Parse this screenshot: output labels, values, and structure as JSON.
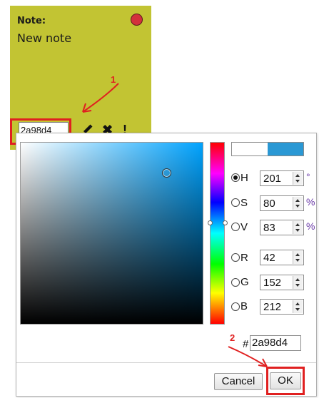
{
  "note": {
    "label": "Note:",
    "body": "New note",
    "background_color": "#c2c433",
    "close_color": "#d3313c",
    "color_value": "2a98d4",
    "tools": {
      "edit_icon": "pencil-icon",
      "delete_icon": "x-icon",
      "priority_icon": "exclamation-icon",
      "delete_glyph": "✖",
      "priority_glyph": "!"
    }
  },
  "annotations": {
    "step1": "1",
    "step2": "2",
    "color": "#e02020"
  },
  "picker": {
    "current_color": "#2a98d4",
    "rows": [
      {
        "label": "H",
        "value": "201",
        "unit": "°",
        "selected": true
      },
      {
        "label": "S",
        "value": "80",
        "unit": "%",
        "selected": false
      },
      {
        "label": "V",
        "value": "83",
        "unit": "%",
        "selected": false
      },
      {
        "label": "R",
        "value": "42",
        "unit": "",
        "selected": false
      },
      {
        "label": "G",
        "value": "152",
        "unit": "",
        "selected": false
      },
      {
        "label": "B",
        "value": "212",
        "unit": "",
        "selected": false
      }
    ],
    "hex_prefix": "#",
    "hex_value": "2a98d4",
    "cancel_label": "Cancel",
    "ok_label": "OK"
  }
}
